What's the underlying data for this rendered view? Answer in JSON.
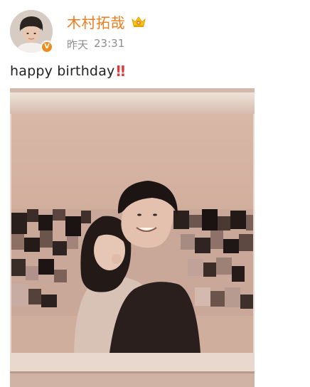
{
  "post": {
    "author": {
      "name": "木村拓哉",
      "avatar_icon": "avatar-photo",
      "verified_icon": "verified-badge-icon",
      "vip_icon": "crown-icon"
    },
    "timestamp": {
      "day": "昨天",
      "time": "23:31"
    },
    "text": "happy birthday",
    "emoji": "‼"
  },
  "colors": {
    "username": "#f07b1d",
    "timestamp": "#8d8d8d",
    "text": "#222222",
    "emoji": "#e23a3a",
    "photo_tone": "#c9a591"
  }
}
